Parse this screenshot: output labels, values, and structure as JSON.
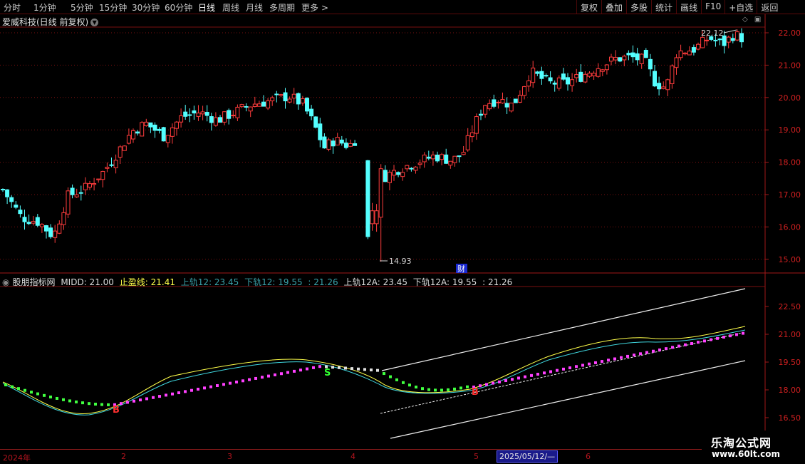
{
  "toolbar": {
    "periods": [
      "分时",
      "1分钟",
      "5分钟",
      "15分钟",
      "30分钟",
      "60分钟",
      "日线",
      "周线",
      "月线",
      "多周期",
      "更多"
    ],
    "active_period": "日线",
    "more_arrow": ">",
    "right_buttons": [
      "复权",
      "叠加",
      "多股",
      "统计",
      "画线",
      "F10",
      "+自选",
      "返回"
    ]
  },
  "main_chart": {
    "title": "爱威科技(日线 前复权)",
    "price_ticks": [
      "22.00",
      "21.00",
      "20.00",
      "19.00",
      "18.00",
      "17.00",
      "16.00",
      "15.00"
    ],
    "high_label": "22.12",
    "low_label": "14.93",
    "fin_badge": "财",
    "colors": {
      "up": "#ff3c3c",
      "down": "#54ffff",
      "grid": "#7a1010"
    }
  },
  "indicator": {
    "name": "股朋指标网",
    "midd": "MIDD: 21.00",
    "stop": "止盈线: 21.41",
    "upper12": "上轨12: 23.45",
    "lower12": "下轨12: 19.55",
    "extra1": ": 21.26",
    "upper12a": "上轨12A: 23.45",
    "lower12a": "下轨12A: 19.55",
    "extra2": ": 21.26",
    "ticks": [
      "22.50",
      "21.00",
      "19.50",
      "18.00",
      "16.50"
    ],
    "signal_b": "B",
    "signal_s": "S"
  },
  "date_axis": {
    "labels": [
      "2024年",
      "2",
      "3",
      "4",
      "5",
      "6"
    ],
    "selected": "2025/05/12/—"
  },
  "watermark": {
    "line1": "乐淘公式网",
    "line2": "www.60lt.com"
  }
}
